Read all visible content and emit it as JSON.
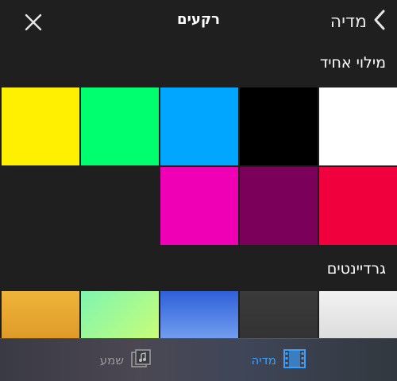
{
  "header": {
    "title": "רקעים",
    "back_label": "מדיה"
  },
  "sections": {
    "solid_title": "מילוי אחיד",
    "gradient_title": "גרדיינטים"
  },
  "solid_colors": [
    "#ffffff",
    "#000000",
    "#00a6ff",
    "#00ff6e",
    "#ffef00",
    "#f0003c",
    "#7a005a",
    "#f000b4"
  ],
  "gradients": [
    "linear-gradient(180deg,#f2f2f2,#cfcfcf)",
    "linear-gradient(180deg,#3a3a3a,#2e2e2e)",
    "linear-gradient(180deg,#2e5fd8,#9ec6ff)",
    "linear-gradient(135deg,#7ff5b0,#d9ff6a)",
    "linear-gradient(180deg,#f0b43a,#d38a1d)"
  ],
  "toolbar": {
    "media_label": "מדיה",
    "audio_label": "שמע",
    "media_color": "#3aa0ff",
    "audio_color": "#9a9a9a"
  }
}
